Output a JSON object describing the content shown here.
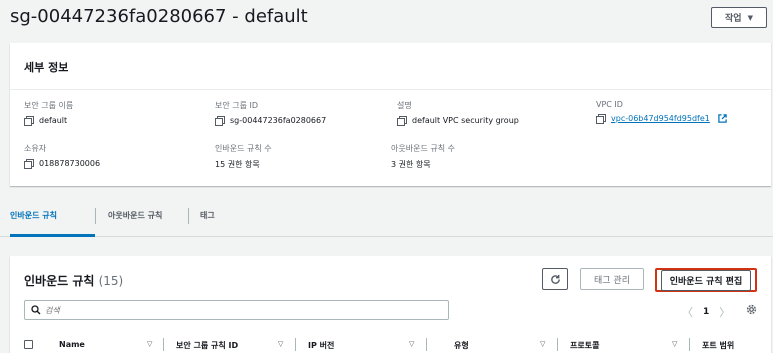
{
  "header": {
    "title": "sg-00447236fa0280667 - default",
    "actions_label": "작업",
    "actions_caret": "▼"
  },
  "details": {
    "heading": "세부 정보",
    "fields": {
      "sg_name": {
        "label": "보안 그룹 이름",
        "value": "default"
      },
      "sg_id": {
        "label": "보안 그룹 ID",
        "value": "sg-00447236fa0280667"
      },
      "description": {
        "label": "설명",
        "value": "default VPC security group"
      },
      "vpc_id": {
        "label": "VPC ID",
        "value": "vpc-06b47d954fd95dfe1"
      },
      "owner": {
        "label": "소유자",
        "value": "018878730006"
      },
      "inbound_count": {
        "label": "인바운드 규칙 수",
        "value": "15 권한 항목"
      },
      "outbound_count": {
        "label": "아웃바운드 규칙 수",
        "value": "3 권한 항목"
      }
    }
  },
  "tabs": [
    {
      "label": "인바운드 규칙"
    },
    {
      "label": "아웃바운드 규칙"
    },
    {
      "label": "태그"
    }
  ],
  "rules": {
    "title": "인바운드 규칙",
    "count": "(15)",
    "tag_manage_label": "태그 관리",
    "edit_label": "인바운드 규칙 편집",
    "search_placeholder": "검색",
    "page": "1",
    "prev": "〈",
    "next": "〉",
    "columns": [
      "Name",
      "보안 그룹 규칙 ID",
      "IP 버전",
      "유형",
      "프로토콜",
      "포트 범위"
    ],
    "sort_glyph": "▽"
  },
  "colors": {
    "accent": "#0073bb",
    "highlight": "#d13212"
  }
}
